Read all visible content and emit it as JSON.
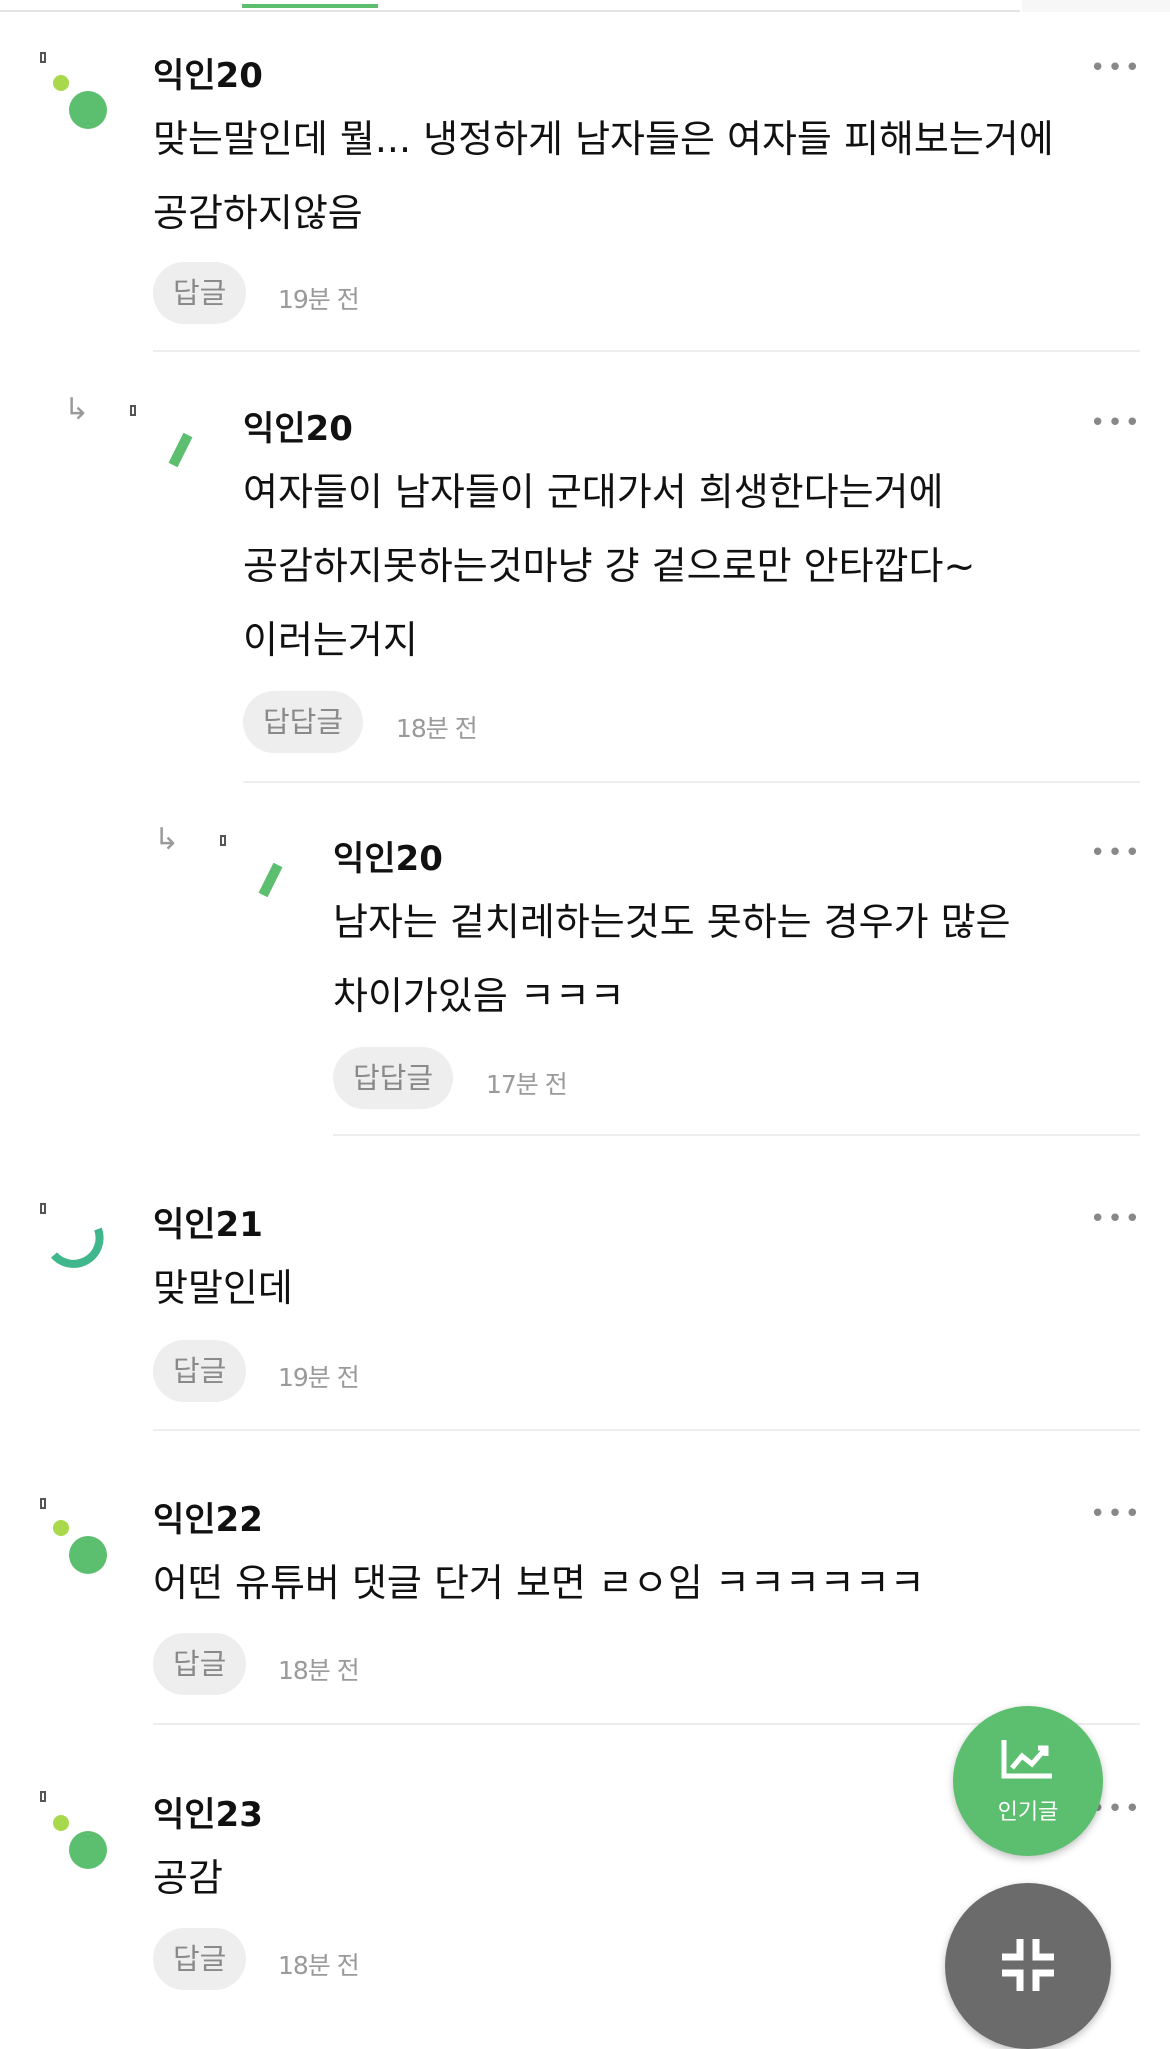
{
  "comments": [
    {
      "name": "익인20",
      "text": "맞는말인데 뭘... 냉정하게 남자들은 여자들 피해보는거에 공감하지않음",
      "reply_label": "답글",
      "time": "19분 전"
    },
    {
      "name": "익인20",
      "text": "여자들이 남자들이 군대가서 희생한다는거에 공감하지못하는것마냥 걍 겉으로만 안타깝다~ 이러는거지",
      "reply_label": "답답글",
      "time": "18분 전"
    },
    {
      "name": "익인20",
      "text": "남자는 겉치레하는것도 못하는 경우가 많은 차이가있음 ㅋㅋㅋ",
      "reply_label": "답답글",
      "time": "17분 전"
    },
    {
      "name": "익인21",
      "text": "맞말인데",
      "reply_label": "답글",
      "time": "19분 전"
    },
    {
      "name": "익인22",
      "text": "어떤 유튜버 댓글 단거 보면 ㄹㅇ임 ㅋㅋㅋㅋㅋㅋ",
      "reply_label": "답글",
      "time": "18분 전"
    },
    {
      "name": "익인23",
      "text": "공감",
      "reply_label": "답글",
      "time": "18분 전"
    }
  ],
  "more_icon": "•••",
  "reply_arrow_icon": "↳",
  "fab_popular": {
    "label": "인기글",
    "icon": "trending-chart-icon"
  },
  "fab_collapse": {
    "icon": "collapse-icon"
  },
  "colors": {
    "accent": "#5cbf6f",
    "light_green": "#a8d84c",
    "teal": "#3fb68b",
    "fab_gray": "#6b6b6b"
  }
}
